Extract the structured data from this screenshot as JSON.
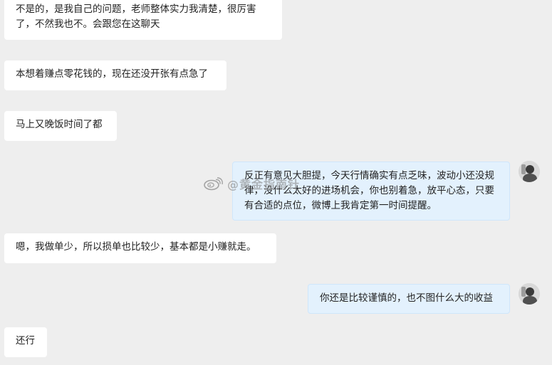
{
  "messages": [
    {
      "id": "m1",
      "side": "left",
      "text": "不是的，是我自己的问题，老师整体实力我清楚，很厉害了，不然我也不。会跟您在这聊天"
    },
    {
      "id": "m2",
      "side": "left",
      "text": "本想着赚点零花钱的，现在还没开张有点急了"
    },
    {
      "id": "m3",
      "side": "left",
      "text": "马上又晚饭时间了都"
    },
    {
      "id": "m4",
      "side": "right",
      "text": "反正有意见大胆提，今天行情确实有点乏味，波动小还没规律，没什么太好的进场机会，你也别着急，放平心态，只要有合适的点位，微博上我肯定第一时间提醒。"
    },
    {
      "id": "m5",
      "side": "left",
      "text": "嗯，我做单少，所以损单也比较少，基本都是小赚就走。"
    },
    {
      "id": "m6",
      "side": "right",
      "text": "你还是比较谨慎的，也不图什么大的收益"
    },
    {
      "id": "m7",
      "side": "left",
      "text": "还行"
    }
  ],
  "watermark": {
    "icon": "weibo-icon",
    "text": "@黄金指南针"
  },
  "colors": {
    "background": "#eeeeee",
    "left_bubble": "#ffffff",
    "right_bubble": "#e3f1fd",
    "text": "#222222"
  }
}
